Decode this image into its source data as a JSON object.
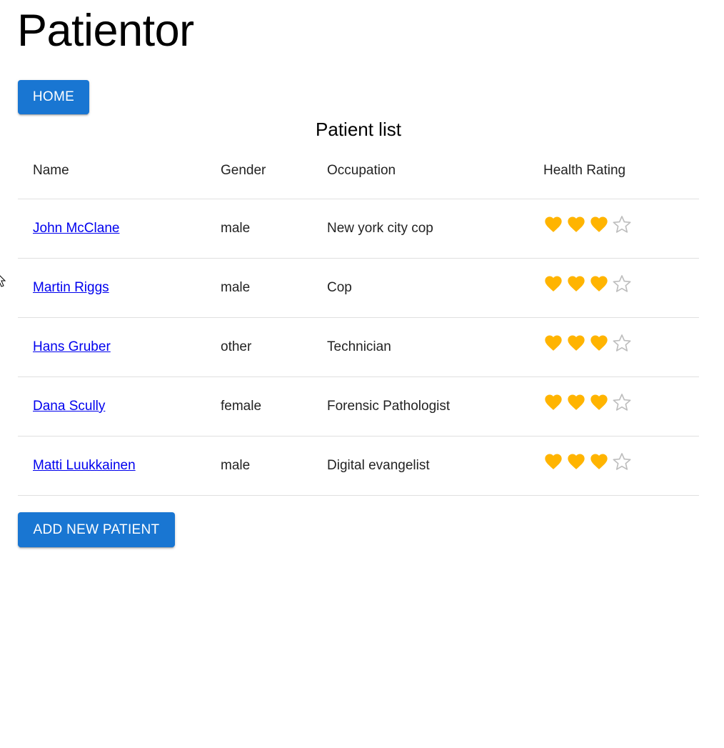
{
  "app": {
    "title": "Patientor"
  },
  "nav": {
    "home_label": "HOME"
  },
  "section": {
    "title": "Patient list"
  },
  "table": {
    "headers": [
      "Name",
      "Gender",
      "Occupation",
      "Health Rating"
    ],
    "rows": [
      {
        "name": "John McClane",
        "gender": "male",
        "occupation": "New york city cop",
        "rating": 3,
        "max": 4
      },
      {
        "name": "Martin Riggs",
        "gender": "male",
        "occupation": "Cop",
        "rating": 3,
        "max": 4
      },
      {
        "name": "Hans Gruber",
        "gender": "other",
        "occupation": "Technician",
        "rating": 3,
        "max": 4
      },
      {
        "name": "Dana Scully",
        "gender": "female",
        "occupation": "Forensic Pathologist",
        "rating": 3,
        "max": 4
      },
      {
        "name": "Matti Luukkainen",
        "gender": "male",
        "occupation": "Digital evangelist",
        "rating": 3,
        "max": 4
      }
    ]
  },
  "actions": {
    "add_label": "ADD NEW PATIENT"
  },
  "icons": {
    "filled": "heart-icon",
    "empty": "star-outline-icon"
  },
  "colors": {
    "primary": "#1976d2",
    "heart": "#ffb400",
    "star_empty": "#bdbdbd",
    "link": "#0000ee"
  }
}
